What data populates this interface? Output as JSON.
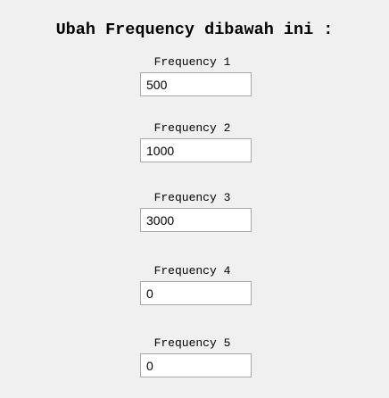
{
  "heading": "Ubah Frequency dibawah ini :",
  "fields": [
    {
      "label": "Frequency 1",
      "value": "500"
    },
    {
      "label": "Frequency 2",
      "value": "1000"
    },
    {
      "label": "Frequency 3",
      "value": "3000"
    },
    {
      "label": "Frequency 4",
      "value": "0"
    },
    {
      "label": "Frequency 5",
      "value": "0"
    }
  ]
}
